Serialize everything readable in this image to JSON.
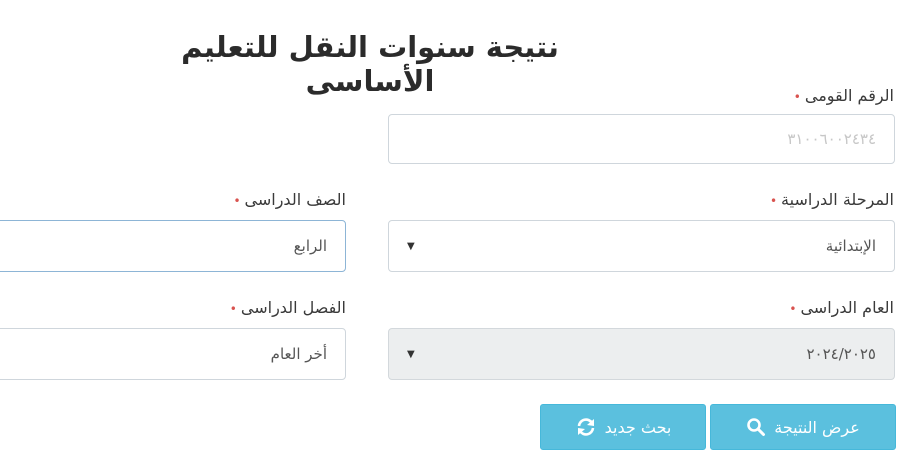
{
  "form": {
    "title": "نتيجة سنوات النقل للتعليم الأساسى",
    "required_mark": "•",
    "national_id": {
      "label": "الرقم القومى",
      "value": "٣١٠٠٦٠٠٢٤٣٤"
    },
    "stage": {
      "label": "المرحلة الدراسية",
      "value": "الإبتدائية"
    },
    "grade": {
      "label": "الصف الدراسى",
      "value": "الرابع"
    },
    "year": {
      "label": "العام الدراسى",
      "value": "٢٠٢٤/٢٠٢٥"
    },
    "term": {
      "label": "الفصل الدراسى",
      "value": "أخر العام"
    },
    "buttons": {
      "show_result": "عرض النتيجة",
      "new_search": "بحث جديد"
    },
    "icons": {
      "search": "search-icon",
      "refresh": "refresh-icon",
      "dropdown": "chevron-down-icon"
    },
    "colors": {
      "button": "#5bc0de",
      "required": "#d9534f",
      "focus_border": "#8db5d6",
      "disabled_bg": "#eceeef"
    }
  }
}
